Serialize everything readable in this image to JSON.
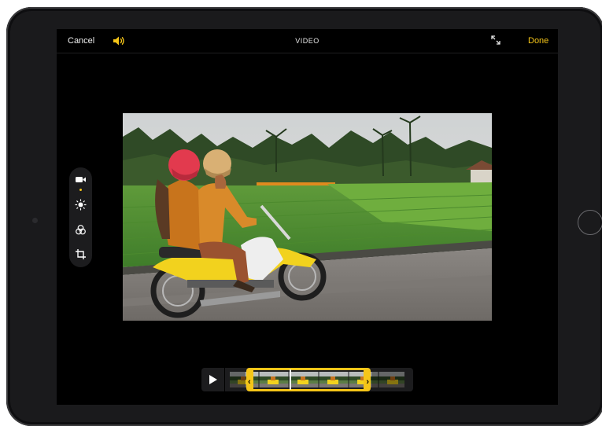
{
  "header": {
    "cancel_label": "Cancel",
    "title": "VIDEO",
    "done_label": "Done"
  },
  "icons": {
    "speaker": "speaker-volume-icon",
    "aspect": "aspect-ratio-icon",
    "tools": [
      "video-camera-icon",
      "adjust-icon",
      "filters-icon",
      "crop-icon"
    ],
    "play": "play-icon"
  },
  "colors": {
    "accent": "#f5c518",
    "screen_bg": "#000000",
    "panel_bg": "#1c1c1e",
    "device_frame": "#1a1a1c"
  },
  "toolbar": {
    "selected_tool": "video-camera-icon"
  }
}
